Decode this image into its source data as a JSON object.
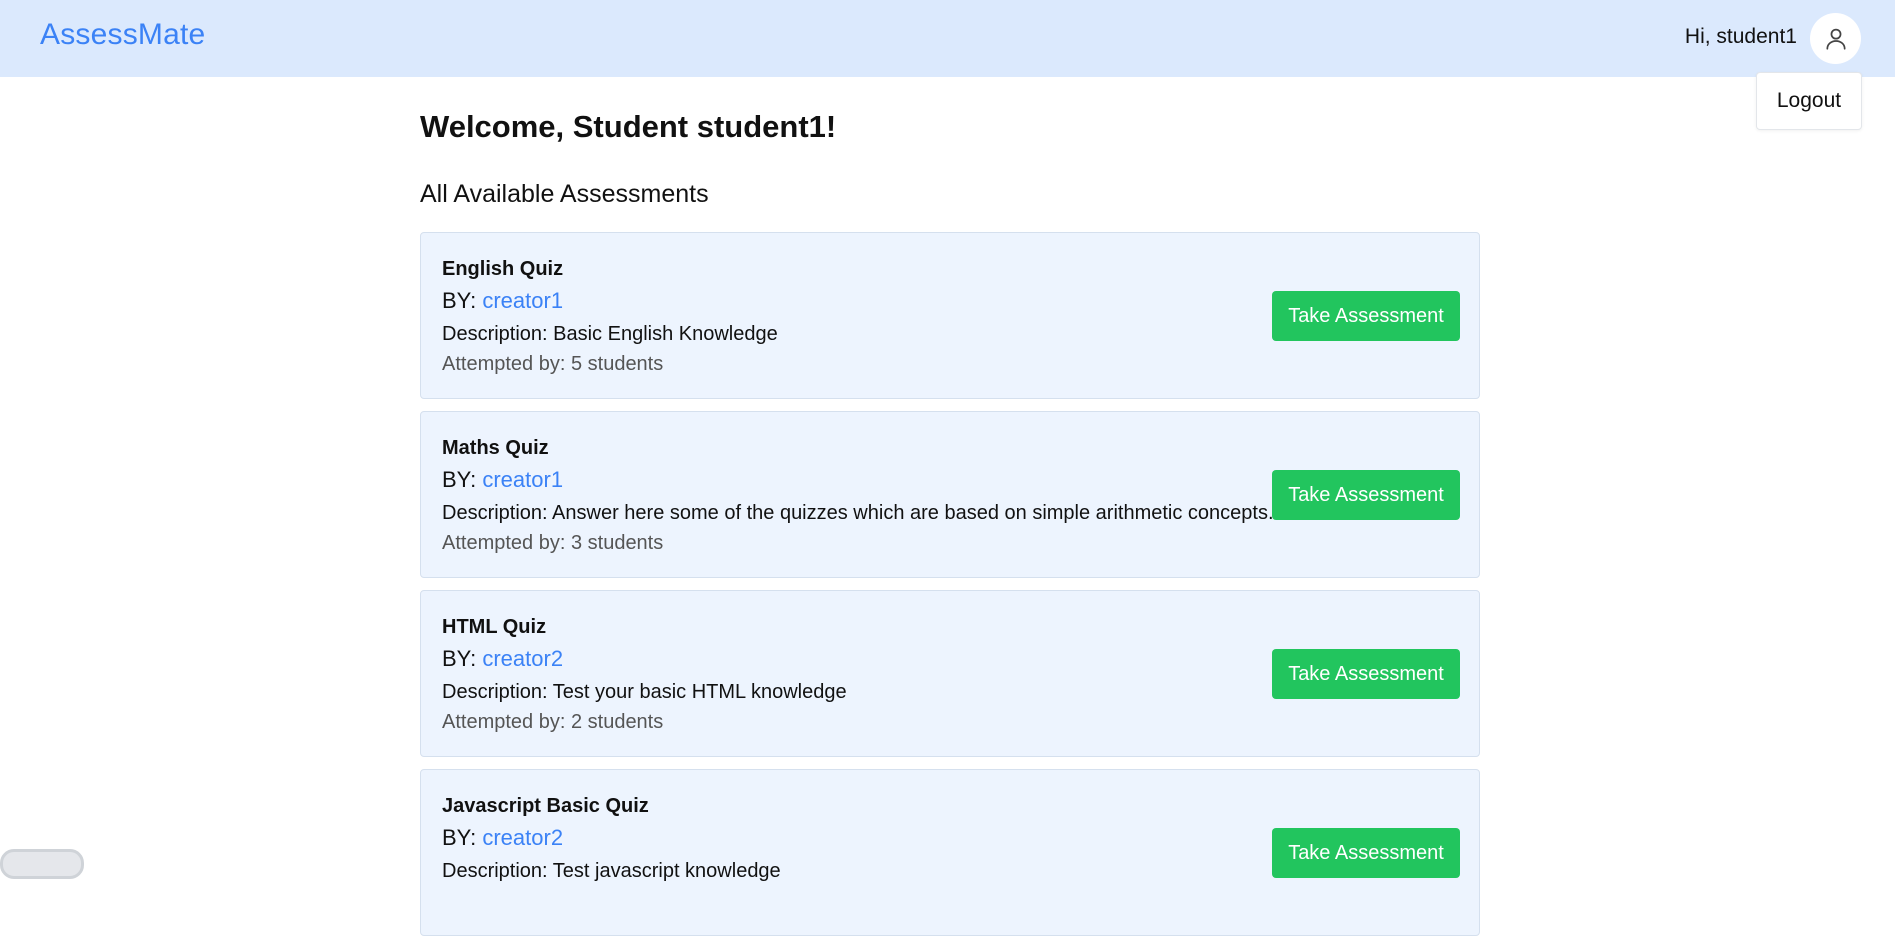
{
  "header": {
    "brand": "AssessMate",
    "greeting": "Hi, student1",
    "avatar_icon": "user-icon",
    "logout_label": "Logout"
  },
  "main": {
    "welcome": "Welcome, Student student1!",
    "section_title": "All Available Assessments",
    "cards": [
      {
        "title": "English Quiz",
        "by_label": "BY: ",
        "creator": "creator1",
        "description": "Description: Basic English Knowledge",
        "attempts": "Attempted by: 5 students",
        "button": "Take Assessment"
      },
      {
        "title": "Maths Quiz",
        "by_label": "BY: ",
        "creator": "creator1",
        "description": "Description: Answer here some of the quizzes which are based on simple arithmetic concepts.",
        "attempts": "Attempted by: 3 students",
        "button": "Take Assessment"
      },
      {
        "title": "HTML Quiz",
        "by_label": "BY: ",
        "creator": "creator2",
        "description": "Description: Test your basic HTML knowledge",
        "attempts": "Attempted by: 2 students",
        "button": "Take Assessment"
      },
      {
        "title": "Javascript Basic Quiz",
        "by_label": "BY: ",
        "creator": "creator2",
        "description": "Description: Test javascript knowledge",
        "attempts": "",
        "button": "Take Assessment"
      }
    ]
  },
  "colors": {
    "navbar_bg": "#dbe9fd",
    "brand": "#3b82f6",
    "card_bg": "#edf4fe",
    "button_bg": "#22c55e"
  }
}
